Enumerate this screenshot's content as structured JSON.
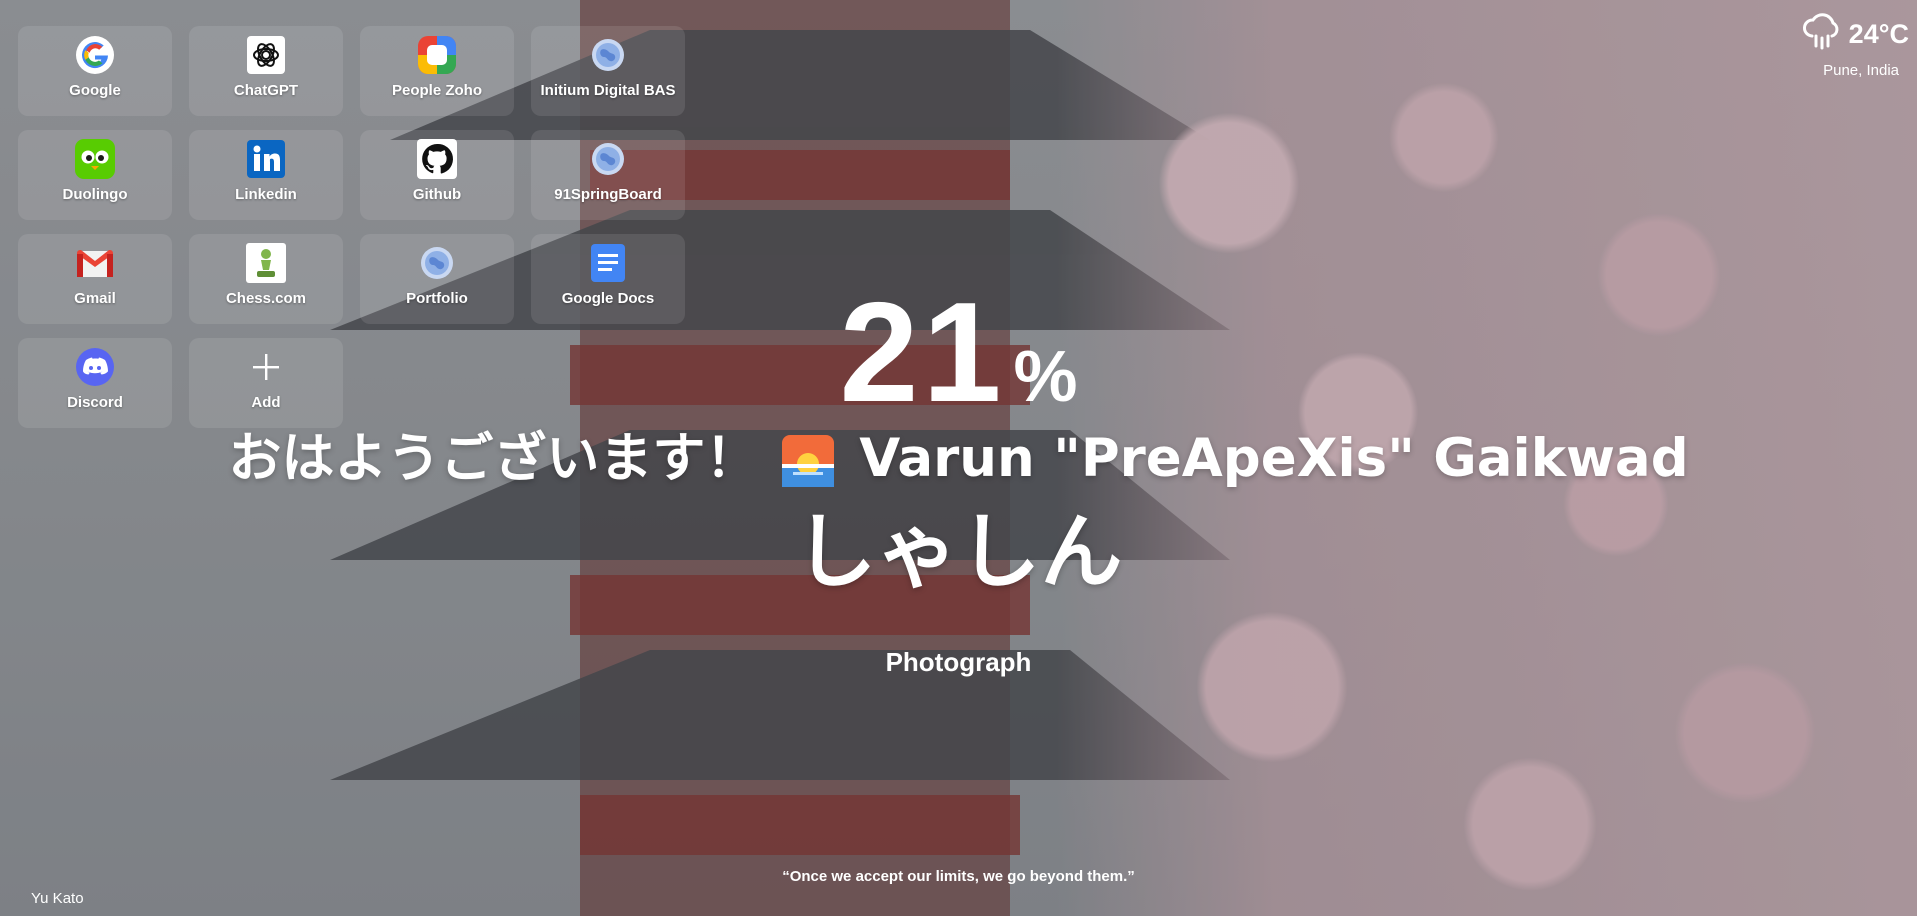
{
  "shortcuts": [
    {
      "label": "Google",
      "icon": "google-icon"
    },
    {
      "label": "ChatGPT",
      "icon": "chatgpt-icon"
    },
    {
      "label": "People Zoho",
      "icon": "zoho-people-icon"
    },
    {
      "label": "Initium Digital BAS",
      "icon": "globe-icon"
    },
    {
      "label": "Duolingo",
      "icon": "duolingo-icon"
    },
    {
      "label": "Linkedin",
      "icon": "linkedin-icon"
    },
    {
      "label": "Github",
      "icon": "github-icon"
    },
    {
      "label": "91SpringBoard",
      "icon": "globe-icon"
    },
    {
      "label": "Gmail",
      "icon": "gmail-icon"
    },
    {
      "label": "Chess.com",
      "icon": "chess-pawn-icon"
    },
    {
      "label": "Portfolio",
      "icon": "globe-icon"
    },
    {
      "label": "Google Docs",
      "icon": "google-docs-icon"
    },
    {
      "label": "Discord",
      "icon": "discord-icon"
    },
    {
      "label": "Add",
      "icon": "plus-icon"
    }
  ],
  "weather": {
    "temperature": "24°C",
    "location": "Pune, India",
    "icon": "rain-cloud-icon"
  },
  "progress": {
    "value": "21",
    "unit": "%"
  },
  "greeting": {
    "prefix": "おはようございます！",
    "icon": "sunrise-icon",
    "name": "Varun \"PreApeXis\" Gaikwad"
  },
  "word": {
    "japanese": "しゃしん",
    "meaning": "Photograph"
  },
  "quote": "“Once we accept our limits, we go beyond them.”",
  "photo_credit": "Yu Kato",
  "colors": {
    "google_blue": "#4285F4",
    "google_red": "#EA4335",
    "google_yellow": "#FBBC05",
    "google_green": "#34A853",
    "linkedin": "#0A66C2",
    "duolingo": "#58CC02",
    "discord": "#5865F2",
    "docs": "#4285F4"
  }
}
